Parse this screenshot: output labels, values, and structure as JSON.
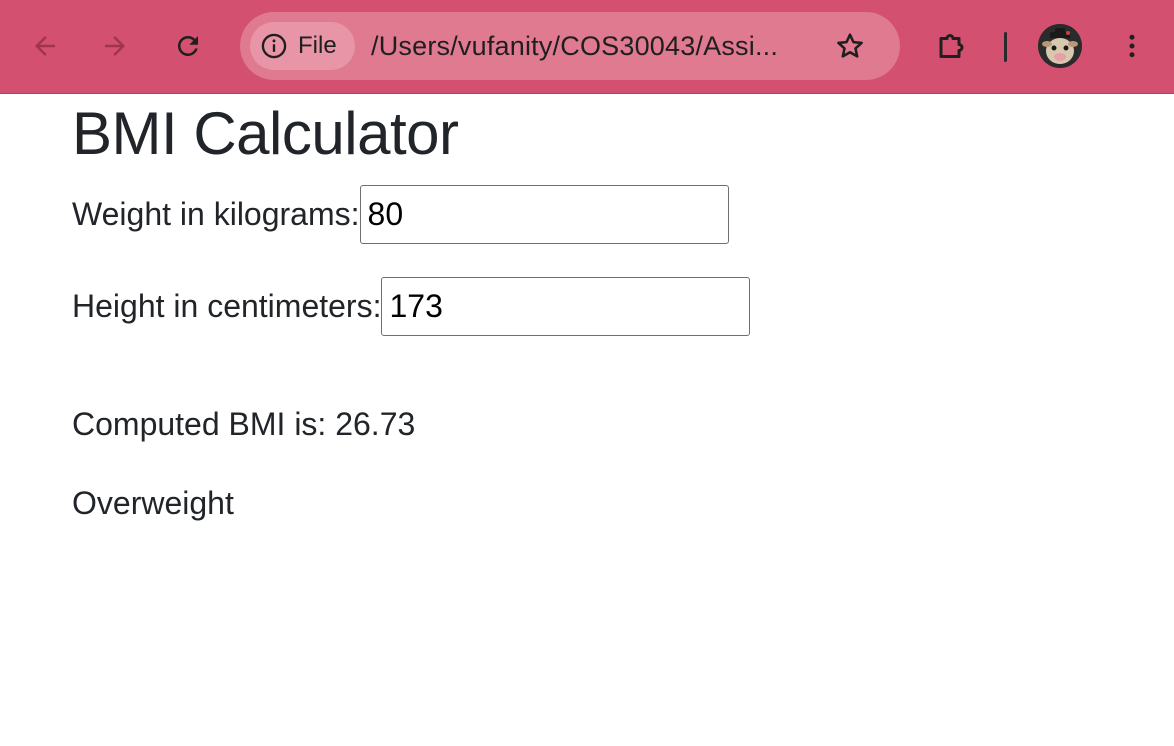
{
  "browser": {
    "site_info_label": "File",
    "url": "/Users/vufanity/COS30043/Assi...",
    "toolbar_color": "#d45070"
  },
  "page": {
    "title": "BMI Calculator",
    "weight": {
      "label": "Weight in kilograms:",
      "value": "80"
    },
    "height": {
      "label": "Height in centimeters:",
      "value": "173"
    },
    "result": {
      "bmi_text": "Computed BMI is: 26.73",
      "category": "Overweight"
    }
  }
}
